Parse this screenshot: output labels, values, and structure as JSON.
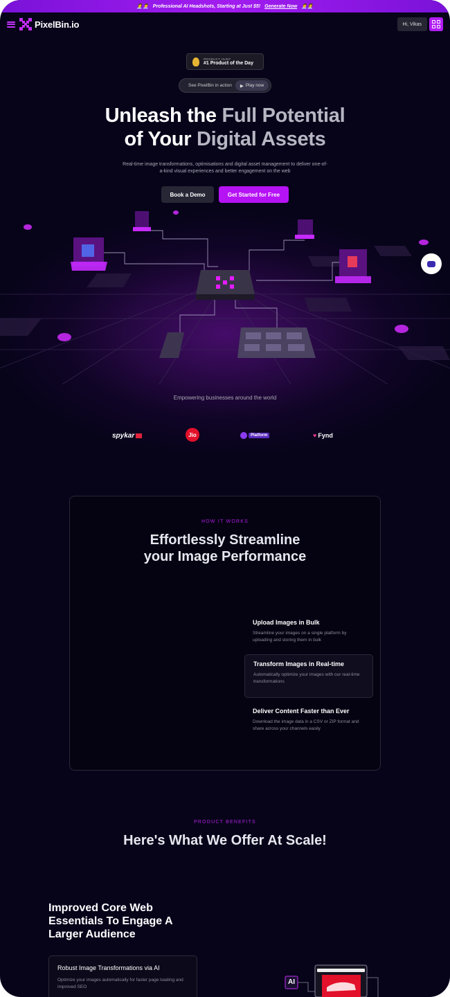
{
  "banner": {
    "emoji": "👩‍💼👨‍💼",
    "text": "Professional AI Headshots, Starting at Just $5!",
    "cta": "Generate Now",
    "emoji_end": "👨‍💼👩‍💼"
  },
  "nav": {
    "brand": "PixelBin.io",
    "greeting": "Hi, Vikas"
  },
  "producthunt": {
    "label": "PRODUCT HUNT",
    "title": "#1 Product of the Day"
  },
  "video": {
    "label": "See PixelBin in action",
    "play": "Play now"
  },
  "hero": {
    "title_line1_a": "Unleash the ",
    "title_line1_b": "Full Potential",
    "title_line2_a": "of Your ",
    "title_line2_b": "Digital Assets",
    "subtitle": "Real-time image transformations, optimisations and digital asset management to deliver one-of-a-kind visual experiences and better engagement on the web",
    "demo_btn": "Book a Demo",
    "start_btn": "Get Started for Free"
  },
  "clients": {
    "heading": "Empowering businesses around the world",
    "logos": [
      "spykar",
      "Jio",
      "Platform",
      "Fynd"
    ]
  },
  "how": {
    "eyebrow": "HOW IT WORKS",
    "title_line1": "Effortlessly Streamline",
    "title_line2": "your Image Performance",
    "steps": [
      {
        "title": "Upload Images in Bulk",
        "desc": "Streamline your images on a single platform by uploading and storing them in bulk"
      },
      {
        "title": "Transform Images in Real-time",
        "desc": "Automatically optimize your images with our real-time transformations"
      },
      {
        "title": "Deliver Content Faster than Ever",
        "desc": "Download the image data in a CSV or ZIP format and share across your channels easily"
      }
    ]
  },
  "benefits": {
    "eyebrow": "PRODUCT BENEFITS",
    "title": "Here's What We Offer At Scale!",
    "subtitle": "Improved Core Web Essentials To Engage A Larger Audience",
    "feature_title": "Robust Image Transformations via AI",
    "feature_desc": "Optimize your images automatically for faster page loading and improved SEO",
    "ai_badge": "AI"
  },
  "colors": {
    "accent": "#b613f5",
    "bg": "#07041a"
  }
}
